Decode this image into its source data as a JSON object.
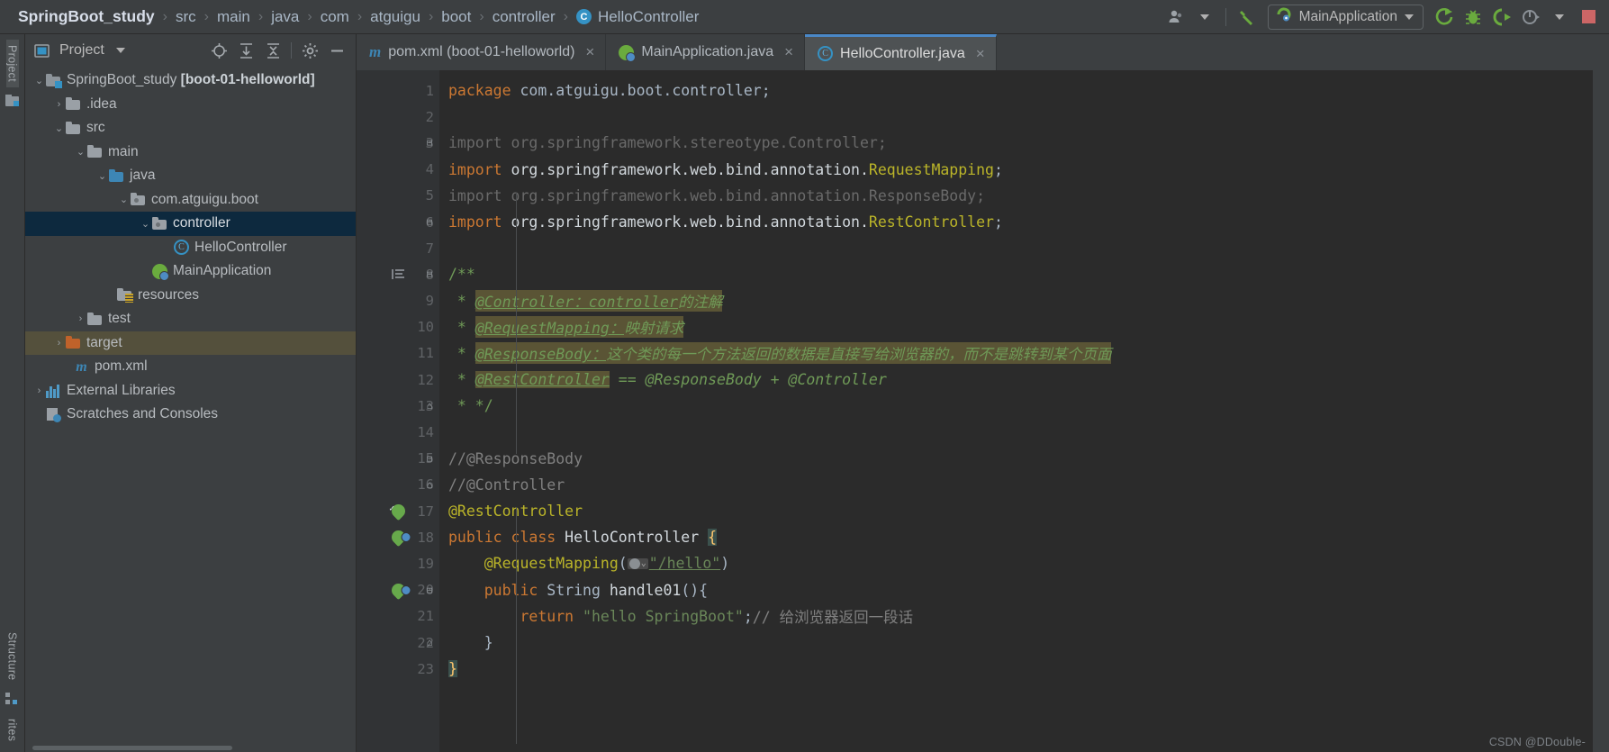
{
  "breadcrumb": {
    "root": "SpringBoot_study",
    "items": [
      "src",
      "main",
      "java",
      "com",
      "atguigu",
      "boot",
      "controller"
    ],
    "file": "HelloController",
    "file_icon": "class-icon",
    "separator": "›"
  },
  "toolbar": {
    "user_icon": "user-avatar-icon",
    "build_icon": "hammer-build-icon",
    "run_config": "MainApplication",
    "run_config_icon": "spring-boot-app-icon",
    "run_icon": "run-icon",
    "debug_icon": "debug-bug-icon",
    "run_coverage_icon": "run-with-coverage-icon",
    "profile_icon": "profiler-icon",
    "stop_icon": "stop-icon",
    "dropdown_caret": "chevron-down-icon"
  },
  "left_strip": {
    "project_tab": "Project",
    "structure_tab": "Structure",
    "favorites_tab": "rites"
  },
  "project_panel": {
    "title": "Project",
    "title_icon": "project-view-icon",
    "title_caret": "chevron-down-icon",
    "actions": [
      {
        "name": "locate-in-tree-icon",
        "label": "Select Opened File"
      },
      {
        "name": "expand-all-icon",
        "label": "Expand All"
      },
      {
        "name": "collapse-all-icon",
        "label": "Collapse All"
      },
      {
        "name": "gear-icon",
        "label": "Settings"
      },
      {
        "name": "hide-icon",
        "label": "Hide"
      }
    ],
    "tree": [
      {
        "label": "SpringBoot_study",
        "suffix": "[boot-01-helloworld]",
        "icon": "project-folder-icon",
        "arrow": "expanded",
        "indent": 0
      },
      {
        "label": ".idea",
        "icon": "folder-grey-icon",
        "arrow": "collapsed",
        "indent": 1
      },
      {
        "label": "src",
        "icon": "folder-grey-icon",
        "arrow": "expanded",
        "indent": 1
      },
      {
        "label": "main",
        "icon": "folder-grey-icon",
        "arrow": "expanded",
        "indent": 2
      },
      {
        "label": "java",
        "icon": "folder-source-blue-icon",
        "arrow": "expanded",
        "indent": 3
      },
      {
        "label": "com.atguigu.boot",
        "icon": "package-icon",
        "arrow": "expanded",
        "indent": 4
      },
      {
        "label": "controller",
        "icon": "package-icon",
        "arrow": "expanded",
        "indent": 5,
        "state": "selected"
      },
      {
        "label": "HelloController",
        "icon": "java-class-icon",
        "arrow": "none",
        "indent": 6
      },
      {
        "label": "MainApplication",
        "icon": "spring-boot-class-icon",
        "arrow": "none",
        "indent": 5
      },
      {
        "label": "resources",
        "icon": "folder-resources-icon",
        "arrow": "none",
        "indent": 4
      },
      {
        "label": "test",
        "icon": "folder-grey-icon",
        "arrow": "collapsed",
        "indent": 3
      },
      {
        "label": "target",
        "icon": "folder-excluded-orange-icon",
        "arrow": "collapsed",
        "indent": 2,
        "state": "highlighted"
      },
      {
        "label": "pom.xml",
        "icon": "maven-icon",
        "arrow": "none",
        "indent": 3
      },
      {
        "label": "External Libraries",
        "icon": "libraries-icon",
        "arrow": "collapsed",
        "indent": 0
      },
      {
        "label": "Scratches and Consoles",
        "icon": "scratches-icon",
        "arrow": "none",
        "indent": 0
      }
    ]
  },
  "editor": {
    "tabs": [
      {
        "label": "pom.xml (boot-01-helloworld)",
        "icon": "maven-icon",
        "active": false,
        "close": "×"
      },
      {
        "label": "MainApplication.java",
        "icon": "spring-boot-class-icon",
        "active": false,
        "close": "×"
      },
      {
        "label": "HelloController.java",
        "icon": "java-class-icon",
        "active": true,
        "close": "×"
      }
    ],
    "lines": [
      {
        "n": "1",
        "gutter": null,
        "fold": null
      },
      {
        "n": "2",
        "gutter": null,
        "fold": null
      },
      {
        "n": "3",
        "gutter": null,
        "fold": "minus-round"
      },
      {
        "n": "4",
        "gutter": null,
        "fold": null
      },
      {
        "n": "5",
        "gutter": null,
        "fold": null
      },
      {
        "n": "6",
        "gutter": null,
        "fold": "minus-round"
      },
      {
        "n": "7",
        "gutter": null,
        "fold": null
      },
      {
        "n": "8",
        "gutter": "doc-lines-icon",
        "fold": "minus-round"
      },
      {
        "n": "9",
        "gutter": null,
        "fold": null
      },
      {
        "n": "10",
        "gutter": null,
        "fold": null
      },
      {
        "n": "11",
        "gutter": null,
        "fold": null
      },
      {
        "n": "12",
        "gutter": null,
        "fold": null
      },
      {
        "n": "13",
        "gutter": null,
        "fold": "fold-end"
      },
      {
        "n": "14",
        "gutter": null,
        "fold": null
      },
      {
        "n": "15",
        "gutter": null,
        "fold": "minus-round"
      },
      {
        "n": "16",
        "gutter": null,
        "fold": "fold-end"
      },
      {
        "n": "17",
        "gutter": "spring-bean-check-icon",
        "fold": null
      },
      {
        "n": "18",
        "gutter": "spring-bean-sub-icon",
        "fold": null
      },
      {
        "n": "19",
        "gutter": null,
        "fold": null
      },
      {
        "n": "20",
        "gutter": "spring-bean-url-icon",
        "fold": "minus-round"
      },
      {
        "n": "21",
        "gutter": null,
        "fold": null
      },
      {
        "n": "22",
        "gutter": null,
        "fold": "fold-end"
      },
      {
        "n": "23",
        "gutter": null,
        "fold": null
      }
    ],
    "code": {
      "l1_kw": "package",
      "l1_rest": " com.atguigu.boot.controller;",
      "l3": "import org.springframework.stereotype.Controller;",
      "l4_kw": "import",
      "l4_pkg": " org.springframework.web.bind.annotation.",
      "l4_cls": "RequestMapping",
      "l4_end": ";",
      "l5": "import org.springframework.web.bind.annotation.ResponseBody;",
      "l6_kw": "import",
      "l6_pkg": " org.springframework.web.bind.annotation.",
      "l6_cls": "RestController",
      "l6_end": ";",
      "l8": "/**",
      "l9_star": " * ",
      "l9_tag": "@Controller：controller",
      "l9_cn": "的注解",
      "l10_star": " * ",
      "l10_tag": "@RequestMapping：",
      "l10_cn": "映射请求",
      "l11_star": " * ",
      "l11_tag": "@ResponseBody：",
      "l11_cn": "这个类的每一个方法返回的数据是直接写给浏览器的，而不是跳转到某个页面",
      "l12_star": " * ",
      "l12_tag": "@RestController",
      "l12_rest": " == @ResponseBody + @Controller",
      "l13": " * */",
      "l15": "//@ResponseBody",
      "l16": "//@Controller",
      "l17": "@RestController",
      "l18_kw1": "public",
      "l18_kw2": " class",
      "l18_name": " HelloController ",
      "l18_brace": "{",
      "l19_ann": "@RequestMapping",
      "l19_open": "(",
      "l19_icon": "web-url-icon",
      "l19_str": "\"/hello\"",
      "l19_close": ")",
      "l20_kw1": "public",
      "l20_type": " String",
      "l20_meth": " handle01",
      "l20_rest": "(){",
      "l21_kw": "return",
      "l21_str": " \"hello SpringBoot\"",
      "l21_semi": ";",
      "l21_cmt": "// 给浏览器返回一段话",
      "l22": "}",
      "l23": "}"
    }
  },
  "watermark": "CSDN @DDouble-"
}
